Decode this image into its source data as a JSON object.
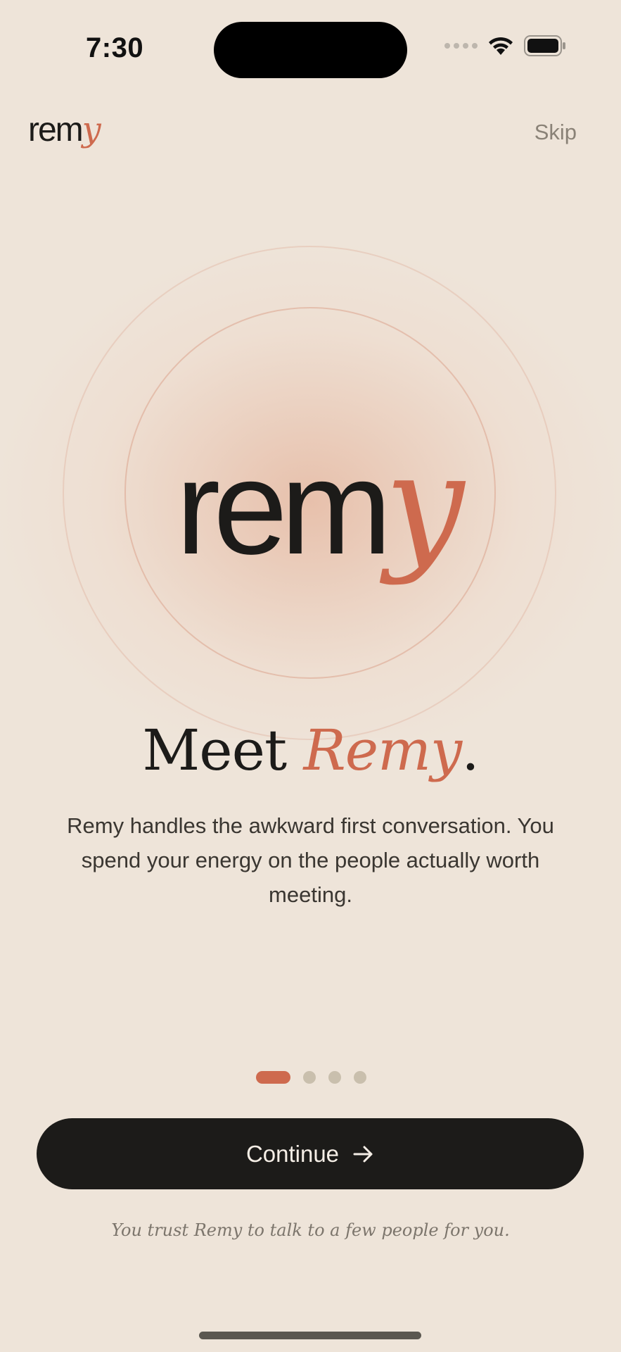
{
  "status_bar": {
    "time": "7:30",
    "icons": [
      "cellular-signal-icon",
      "wifi-icon",
      "battery-icon"
    ]
  },
  "header": {
    "logo": {
      "main": "rem",
      "accent": "y"
    },
    "skip_label": "Skip"
  },
  "hero": {
    "logo": {
      "main": "rem",
      "accent": "y"
    }
  },
  "headline": {
    "prefix": "Meet ",
    "accent": "Remy",
    "suffix": "."
  },
  "description": "Remy handles the awkward first conversation. You spend your energy on the people actually worth meeting.",
  "pager": {
    "total_pages": 4,
    "current_page": 1
  },
  "continue_button": {
    "label": "Continue",
    "icon": "arrow-right-icon"
  },
  "footnote": "You trust Remy to talk to a few people for you.",
  "colors": {
    "background": "#EEE4D9",
    "accent": "#CE6A4E",
    "primary_dark": "#1C1B19",
    "muted_text": "#8A8277",
    "inactive_dot": "#C9BFAD"
  }
}
